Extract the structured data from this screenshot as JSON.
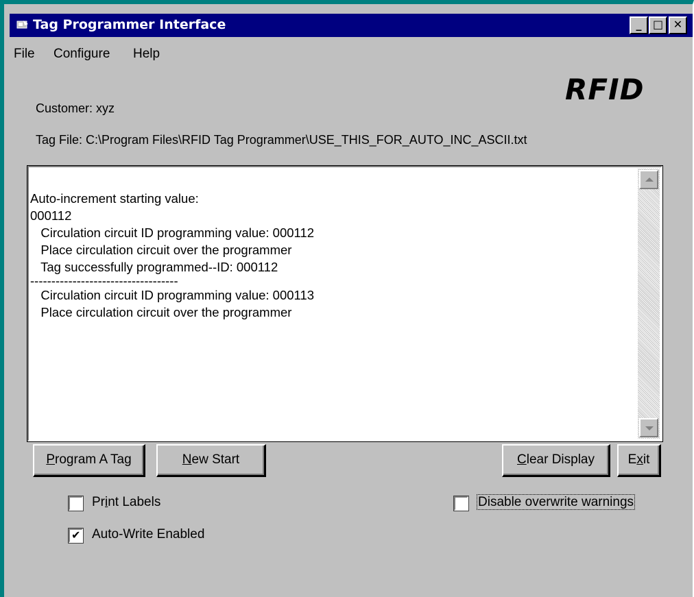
{
  "window": {
    "title": "Tag Programmer Interface",
    "controls": [
      "_",
      "□",
      "✕"
    ]
  },
  "menu": {
    "items": [
      "File",
      "Configure",
      "Help"
    ]
  },
  "logo": "RFID",
  "info": {
    "customer": "Customer: xyz",
    "tag_file": "Tag File: C:\\Program Files\\RFID Tag Programmer\\USE_THIS_FOR_AUTO_INC_ASCII.txt"
  },
  "log": {
    "lines": [
      "Auto-increment starting value:",
      "000112",
      "   Circulation circuit ID programming value: 000112",
      "   Place circulation circuit over the programmer",
      "   Tag successfully programmed--ID: 000112",
      "-----------------------------------",
      "   Circulation circuit ID programming value: 000113",
      "   Place circulation circuit over the programmer"
    ]
  },
  "buttons": {
    "program_tag": {
      "accel": "P",
      "rest": "rogram A Tag"
    },
    "new_start": {
      "accel": "N",
      "rest": "ew Start"
    },
    "clear_display": {
      "accel": "C",
      "rest": "lear Display"
    },
    "exit": {
      "pre": "E",
      "accel": "x",
      "rest": "it"
    }
  },
  "checkboxes": {
    "print_labels": {
      "pre": "Pr",
      "accel": "i",
      "rest": "nt Labels",
      "checked": false
    },
    "auto_write": {
      "label": "Auto-Write Enabled",
      "checked": true
    },
    "disable_overwrite": {
      "label": "Disable overwrite warnings",
      "checked": false
    }
  },
  "colors": {
    "titlebar": "#000080",
    "window_face": "#c0c0c0",
    "desktop": "#008080"
  }
}
